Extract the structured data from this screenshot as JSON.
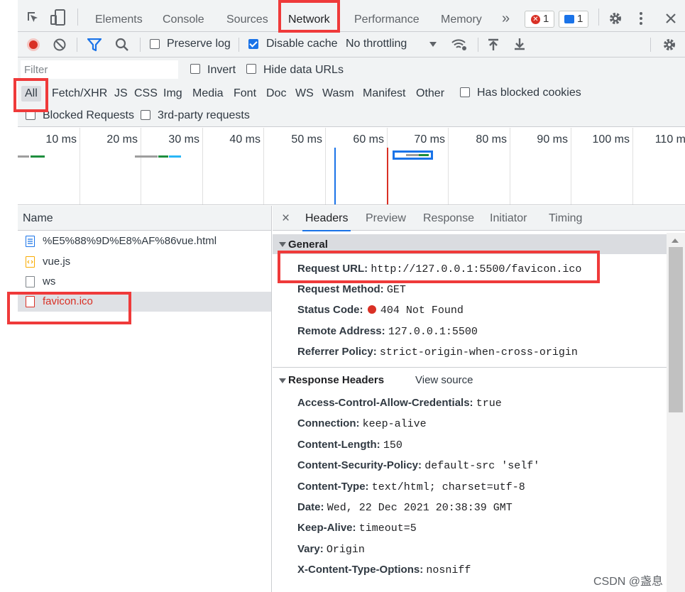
{
  "tabs": {
    "items": [
      "Elements",
      "Console",
      "Sources",
      "Network",
      "Performance",
      "Memory"
    ],
    "more": "»",
    "errors_count": "1",
    "messages_count": "1"
  },
  "toolbar": {
    "preserve_log": "Preserve log",
    "disable_cache": "Disable cache",
    "throttling": "No throttling"
  },
  "filter": {
    "placeholder": "Filter",
    "invert": "Invert",
    "hide_data_urls": "Hide data URLs",
    "types": [
      "All",
      "Fetch/XHR",
      "JS",
      "CSS",
      "Img",
      "Media",
      "Font",
      "Doc",
      "WS",
      "Wasm",
      "Manifest",
      "Other"
    ],
    "has_blocked_cookies": "Has blocked cookies",
    "blocked_requests": "Blocked Requests",
    "third_party": "3rd-party requests"
  },
  "overview": {
    "ticks": [
      "10 ms",
      "20 ms",
      "30 ms",
      "40 ms",
      "50 ms",
      "60 ms",
      "70 ms",
      "80 ms",
      "90 ms",
      "100 ms",
      "110 ms"
    ],
    "colors": {
      "dom_content_loaded": "#1a73e8",
      "load": "#d93025",
      "waiting": "#9e9e9e",
      "download": "#1e8e3e",
      "request": "#29b6f6"
    }
  },
  "requests": {
    "header": "Name",
    "rows": [
      {
        "name": "%E5%88%9D%E8%AF%86vue.html",
        "icon": "document-icon"
      },
      {
        "name": "vue.js",
        "icon": "script-icon"
      },
      {
        "name": "ws",
        "icon": "file-icon"
      },
      {
        "name": "favicon.ico",
        "icon": "file-icon"
      }
    ]
  },
  "details": {
    "close": "×",
    "tabs": [
      "Headers",
      "Preview",
      "Response",
      "Initiator",
      "Timing"
    ],
    "general": {
      "title": "General",
      "request_url_k": "Request URL:",
      "request_url_v": "http://127.0.0.1:5500/favicon.ico",
      "method_k": "Request Method:",
      "method_v": "GET",
      "status_k": "Status Code:",
      "status_v": "404 Not Found",
      "remote_k": "Remote Address:",
      "remote_v": "127.0.0.1:5500",
      "referrer_k": "Referrer Policy:",
      "referrer_v": "strict-origin-when-cross-origin"
    },
    "response_headers": {
      "title": "Response Headers",
      "view_source": "View source",
      "items": [
        {
          "k": "Access-Control-Allow-Credentials:",
          "v": "true"
        },
        {
          "k": "Connection:",
          "v": "keep-alive"
        },
        {
          "k": "Content-Length:",
          "v": "150"
        },
        {
          "k": "Content-Security-Policy:",
          "v": "default-src 'self'"
        },
        {
          "k": "Content-Type:",
          "v": "text/html; charset=utf-8"
        },
        {
          "k": "Date:",
          "v": "Wed, 22 Dec 2021 20:38:39 GMT"
        },
        {
          "k": "Keep-Alive:",
          "v": "timeout=5"
        },
        {
          "k": "Vary:",
          "v": "Origin"
        },
        {
          "k": "X-Content-Type-Options:",
          "v": "nosniff"
        }
      ]
    }
  },
  "watermark": "CSDN @盏息",
  "colors": {
    "accent": "#1a73e8",
    "error": "#d93025",
    "highlight": "#ef3a3a"
  }
}
